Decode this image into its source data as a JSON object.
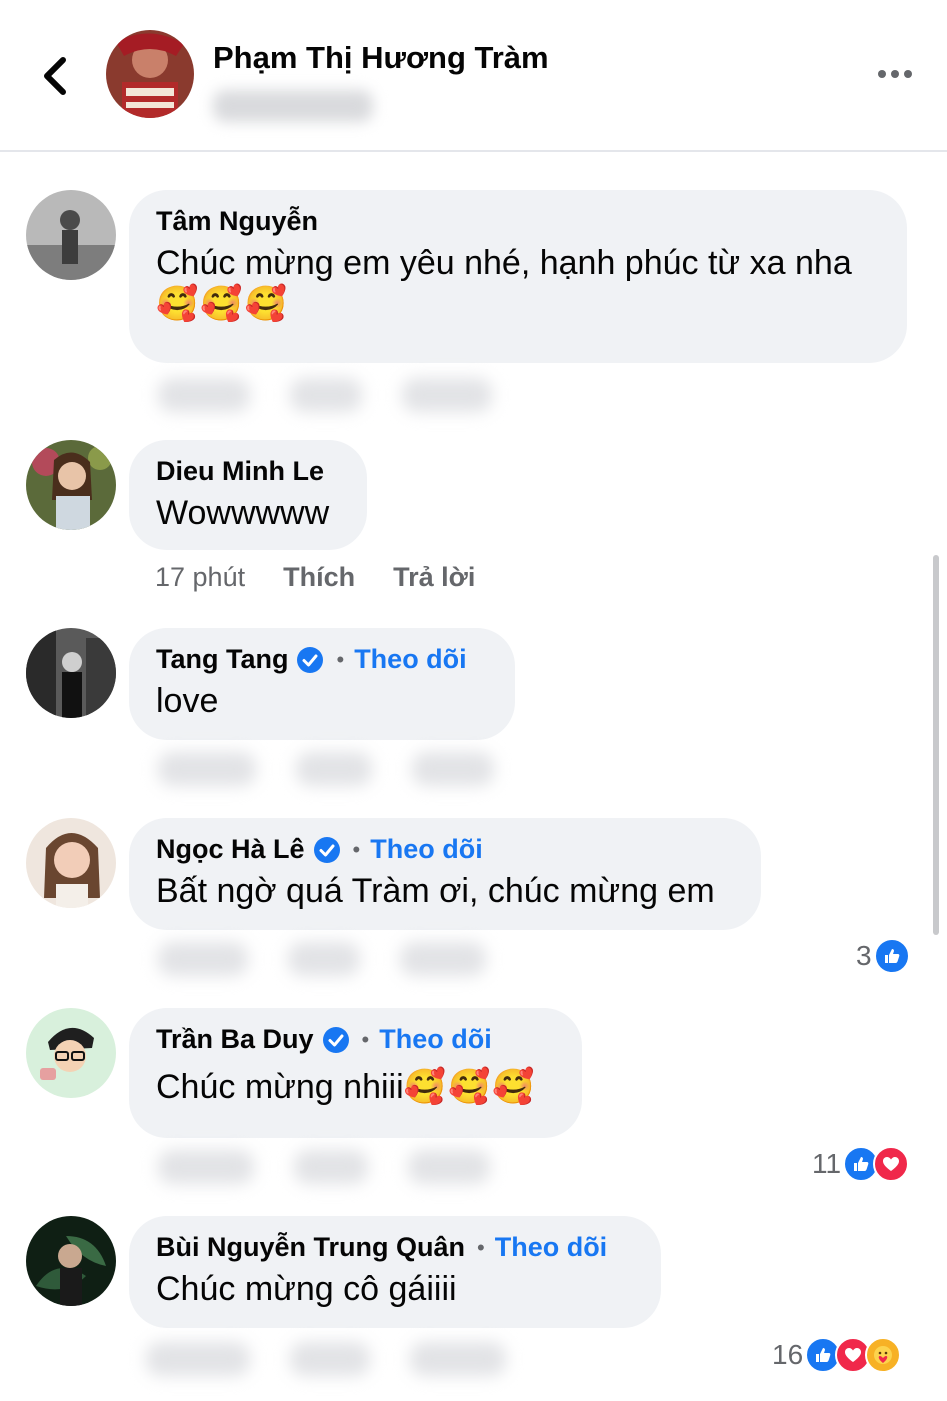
{
  "header": {
    "name": "Phạm Thị Hương Tràm",
    "back_icon": "chevron-left-icon",
    "more_icon": "more-horizontal-icon"
  },
  "comments": [
    {
      "author": "Tâm Nguyễn",
      "text": "Chúc mừng em yêu nhé, hạnh phúc từ xa nha",
      "emoji": "🥰🥰🥰",
      "verified": false
    },
    {
      "author": "Dieu Minh Le",
      "text": "Wowwwww",
      "verified": false,
      "time": "17 phút",
      "like_label": "Thích",
      "reply_label": "Trả lời"
    },
    {
      "author": "Tang Tang",
      "verified": true,
      "follow": "Theo dõi",
      "text": "love"
    },
    {
      "author": "Ngọc Hà Lê",
      "verified": true,
      "follow": "Theo dõi",
      "text": "Bất ngờ quá Tràm ơi, chúc mừng em",
      "reaction_count": "3"
    },
    {
      "author": "Trần Ba Duy",
      "verified": true,
      "follow": "Theo dõi",
      "text": "Chúc mừng nhiii",
      "emoji": "🥰🥰🥰",
      "reaction_count": "11"
    },
    {
      "author": "Bùi Nguyễn Trung Quân",
      "verified": false,
      "follow": "Theo dõi",
      "text": "Chúc mừng cô gáiiii",
      "reaction_count": "16"
    }
  ],
  "colors": {
    "accent": "#1877f2",
    "bubble": "#f0f2f5",
    "muted": "#65676b",
    "love": "#f0284a",
    "care": "#f7b125"
  }
}
